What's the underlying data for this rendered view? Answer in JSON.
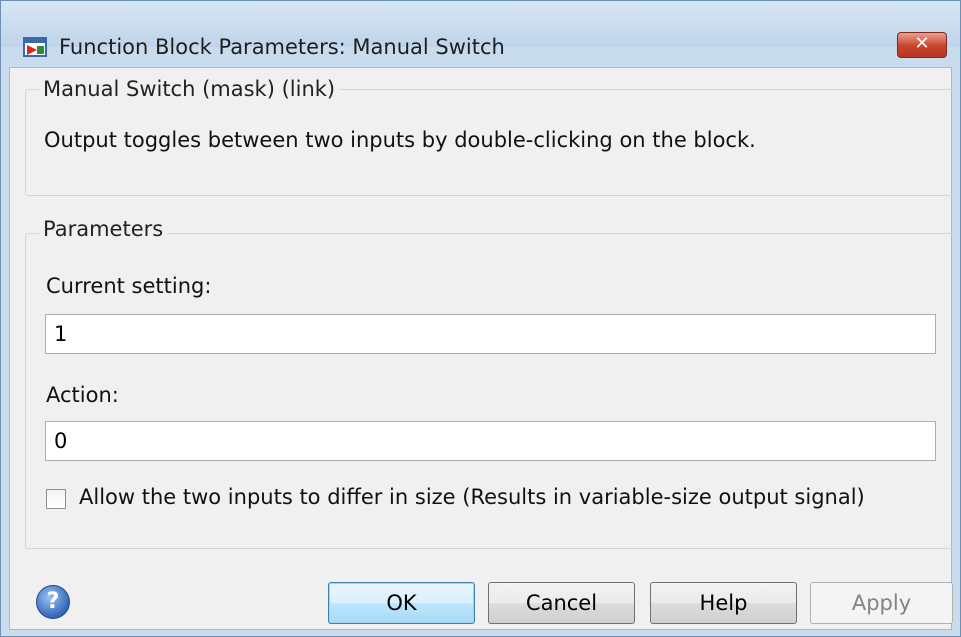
{
  "window": {
    "title": "Function Block Parameters: Manual Switch",
    "close_label": "✕",
    "colors": {
      "titlebar": "#c9dcee",
      "close": "#c8442b",
      "default_button": "#bee6fd"
    }
  },
  "mask_group": {
    "legend": "Manual Switch (mask) (link)",
    "description": "Output toggles between two inputs by double-clicking on the block."
  },
  "parameters": {
    "legend": "Parameters",
    "current_setting": {
      "label": "Current setting:",
      "value": "1"
    },
    "action": {
      "label": "Action:",
      "value": "0"
    },
    "allow_differ": {
      "label": "Allow the two inputs to differ in size (Results in variable-size output signal)",
      "checked": false
    }
  },
  "buttons": {
    "help_icon": "?",
    "ok": "OK",
    "cancel": "Cancel",
    "help": "Help",
    "apply": "Apply"
  },
  "icons": [
    "app-icon",
    "close-icon",
    "help-icon",
    "checkbox"
  ]
}
